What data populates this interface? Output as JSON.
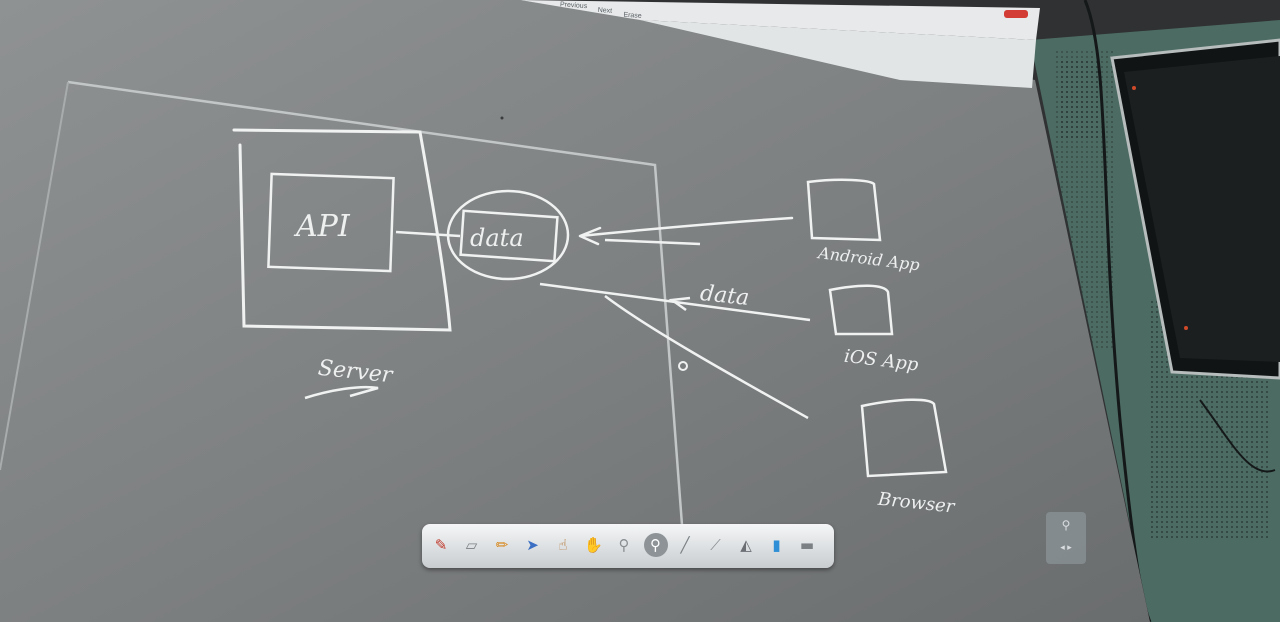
{
  "top_menu": {
    "previous_label": "Previous",
    "next_label": "Next",
    "erase_label": "Erase"
  },
  "whiteboard": {
    "server_box": {
      "api_label": "API",
      "caption": "Server"
    },
    "center": {
      "data_label": "data",
      "arrow_label": "data"
    },
    "clients": [
      {
        "label": "Android App"
      },
      {
        "label": "iOS App"
      },
      {
        "label": "Browser"
      }
    ]
  },
  "toolbar": {
    "tools": [
      {
        "icon": "pen-icon",
        "glyph": "✎",
        "color": "#c0392b"
      },
      {
        "icon": "eraser-icon",
        "glyph": "▱",
        "color": "#7a7f83"
      },
      {
        "icon": "highlighter-icon",
        "glyph": "✏",
        "color": "#d8891e"
      },
      {
        "icon": "select-arrow-icon",
        "glyph": "➤",
        "color": "#3a6fc4"
      },
      {
        "icon": "hand-pointer-icon",
        "glyph": "☝",
        "color": "#b47a3c"
      },
      {
        "icon": "pan-hand-icon",
        "glyph": "✋",
        "color": "#c2894d"
      },
      {
        "icon": "laser-pointer-icon",
        "glyph": "⚲",
        "color": "#8a8e92"
      },
      {
        "icon": "zoom-icon",
        "glyph": "⚲",
        "color": "#ffffff"
      },
      {
        "icon": "marker-icon",
        "glyph": "╱",
        "color": "#7b8085"
      },
      {
        "icon": "line-tool-icon",
        "glyph": "⟋",
        "color": "#8a8e92"
      },
      {
        "icon": "shapes-icon",
        "glyph": "◭",
        "color": "#6c7075"
      },
      {
        "icon": "background-icon",
        "glyph": "▮",
        "color": "#2e8fd6"
      },
      {
        "icon": "screen-icon",
        "glyph": "▬",
        "color": "#7b8085"
      }
    ]
  }
}
